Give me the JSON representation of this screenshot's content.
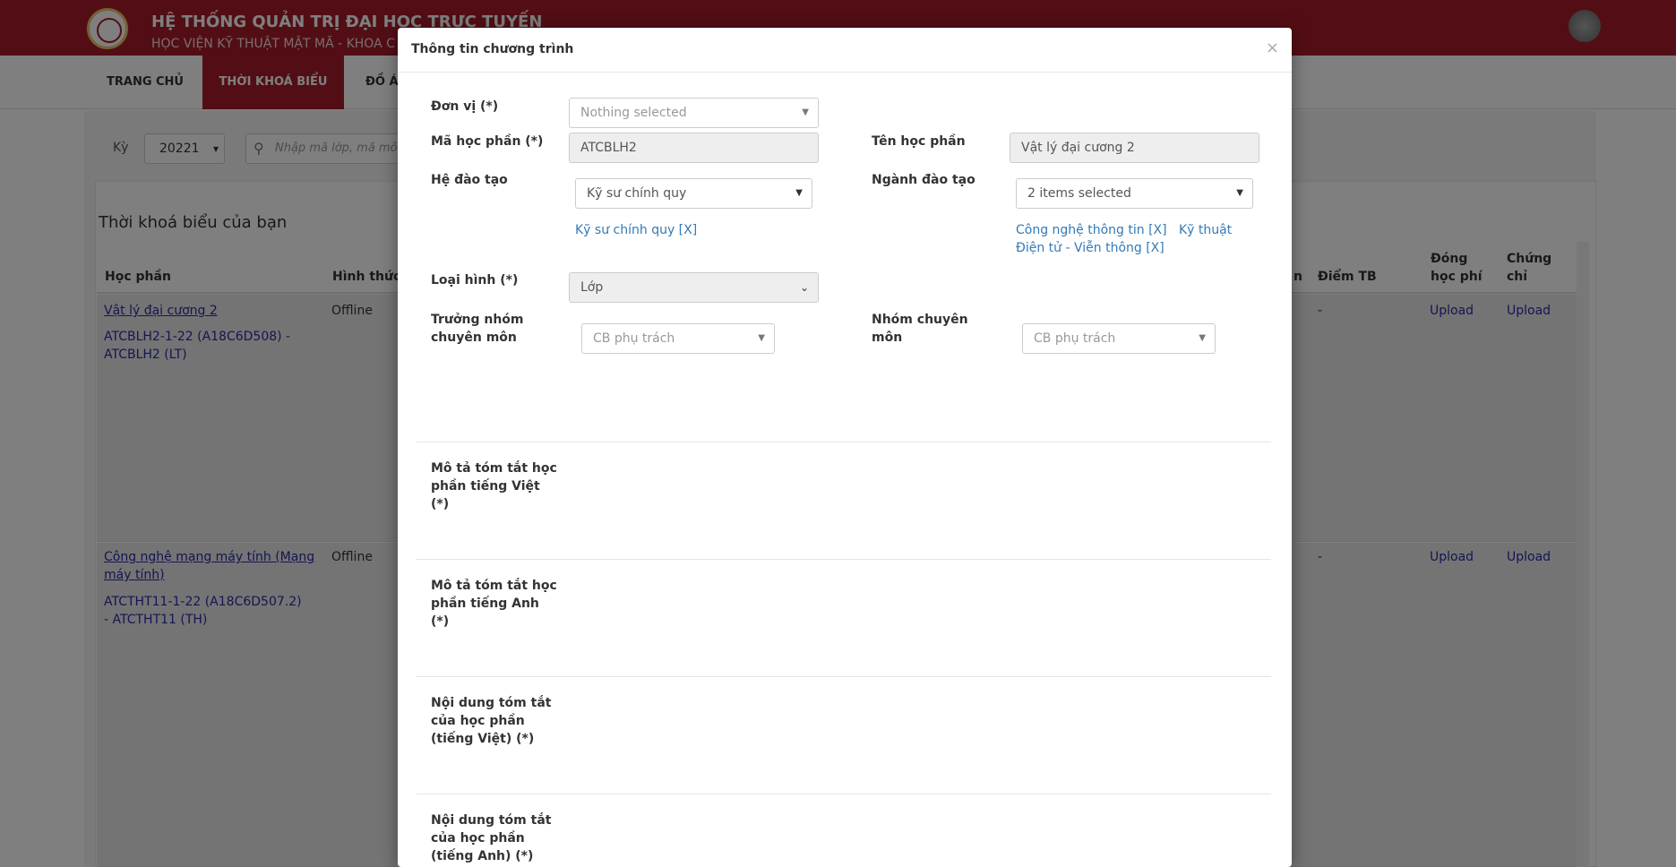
{
  "header": {
    "title": "HỆ THỐNG QUẢN TRỊ ĐẠI HỌC TRỰC TUYẾN",
    "subtitle": "HỌC VIỆN KỸ THUẬT MẬT MÃ - KHOA C"
  },
  "nav": {
    "items": [
      {
        "label": "TRANG CHỦ"
      },
      {
        "label": "THỜI KHOÁ BIỂU"
      },
      {
        "label": "ĐỒ Á"
      }
    ]
  },
  "filter": {
    "ky_label": "Kỳ",
    "ky_value": "20221",
    "search_placeholder": "Nhập mã lớp, mã môn"
  },
  "schedule": {
    "title": "Thời khoá biểu của bạn",
    "columns": {
      "hoc_phan": "Học phần",
      "hinh_thuc": "Hình thức",
      "partial": "n",
      "diem_tb": "Điểm TB",
      "dong_hoc_phi": "Đóng học phí",
      "chung_chi": "Chứng chỉ"
    },
    "rows": [
      {
        "course": "Vật lý đại cương 2",
        "class_info": "ATCBLH2-1-22 (A18C6D508) - ATCBLH2 (LT)",
        "mode": "Offline",
        "score": "-",
        "fee": "Upload",
        "cert": "Upload"
      },
      {
        "course": "Công nghệ mạng máy tính (Mạng máy tính)",
        "class_info": "ATCTHT11-1-22 (A18C6D507.2) - ATCTHT11 (TH)",
        "mode": "Offline",
        "score": "-",
        "fee": "Upload",
        "cert": "Upload"
      }
    ]
  },
  "modal": {
    "title": "Thông tin chương trình",
    "close": "×",
    "don_vi": {
      "label": "Đơn vị (*)",
      "placeholder": "Nothing selected"
    },
    "ma_hoc_phan": {
      "label": "Mã học phần (*)",
      "value": "ATCBLH2"
    },
    "ten_hoc_phan": {
      "label": "Tên học phần",
      "value": "Vật lý đại cương 2"
    },
    "he_dao_tao": {
      "label": "Hệ đào tạo",
      "value": "Kỹ sư chính quy",
      "tag": "Kỹ sư chính quy [X]"
    },
    "nganh_dao_tao": {
      "label": "Ngành đào tạo",
      "value": "2 items selected",
      "tags_line1": "Công nghệ thông tin [X]   Kỹ thuật",
      "tags_line2": "Điện tử - Viễn thông [X]"
    },
    "loai_hinh": {
      "label": "Loại hình (*)",
      "value": "Lớp"
    },
    "truong_nhom": {
      "label_line1": "Trưởng nhóm",
      "label_line2": "chuyên môn",
      "placeholder": "CB phụ trách"
    },
    "nhom_chuyen_mon": {
      "label_line1": "Nhóm chuyên",
      "label_line2": "môn",
      "placeholder": "CB phụ trách"
    },
    "mo_ta_viet": {
      "line1": "Mô tả tóm tắt học",
      "line2": "phần tiếng Việt",
      "line3": "(*)"
    },
    "mo_ta_anh": {
      "line1": "Mô tả tóm tắt học",
      "line2": "phần tiếng Anh",
      "line3": "(*)"
    },
    "noi_dung_viet": {
      "line1": "Nội dung tóm tắt",
      "line2": "của học phần",
      "line3": "(tiếng Việt) (*)"
    },
    "noi_dung_anh": {
      "line1": "Nội dung tóm tắt",
      "line2": "của học phần",
      "line3": "(tiếng Anh) (*)"
    }
  }
}
